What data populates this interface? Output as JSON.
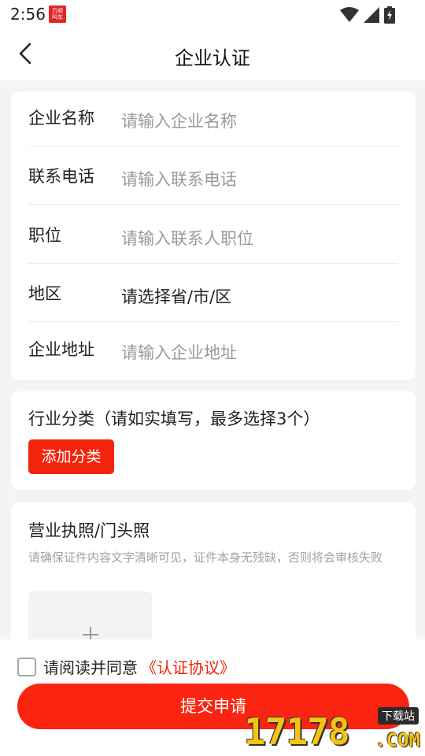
{
  "status_bar": {
    "time": "2:56",
    "app_badge_line1": "万顺",
    "app_badge_line2": "叫车",
    "icons": [
      "wifi-icon",
      "signal-icon",
      "battery-charging-icon"
    ]
  },
  "header": {
    "title": "企业认证",
    "back_icon": "chevron-left-icon"
  },
  "form": {
    "rows": [
      {
        "label": "企业名称",
        "placeholder": "请输入企业名称"
      },
      {
        "label": "联系电话",
        "placeholder": "请输入联系电话"
      },
      {
        "label": "职位",
        "placeholder": "请输入联系人职位"
      },
      {
        "label": "地区",
        "value": "请选择省/市/区"
      },
      {
        "label": "企业地址",
        "placeholder": "请输入企业地址"
      }
    ]
  },
  "industry": {
    "title": "行业分类（请如实填写，最多选择3个）",
    "add_button": "添加分类"
  },
  "license": {
    "title": "营业执照/门头照",
    "hint": "请确保证件内容文字清晰可见，证件本身无残缺，否则将会审核失败",
    "upload_icon": "plus-icon"
  },
  "agreement": {
    "text": "请阅读并同意",
    "link": "《认证协议》",
    "checked": false
  },
  "submit": {
    "label": "提交申请"
  },
  "watermark": {
    "number": "17178",
    "domain": ".COM",
    "tag": "下载站"
  },
  "colors": {
    "accent": "#f3240c",
    "submit": "#fa2411",
    "placeholder": "#9a9a9a",
    "background": "#f4f4f4"
  }
}
